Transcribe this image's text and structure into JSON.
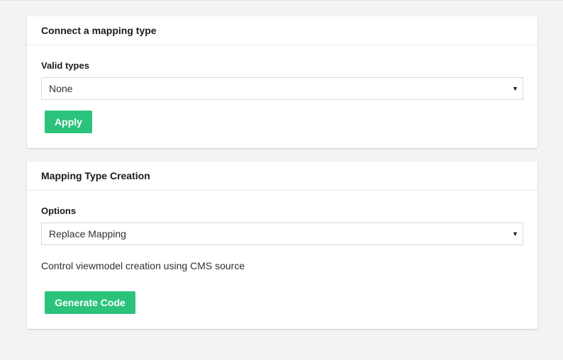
{
  "panel1": {
    "title": "Connect a mapping type",
    "label": "Valid types",
    "select_value": "None",
    "button_label": "Apply"
  },
  "panel2": {
    "title": "Mapping Type Creation",
    "label": "Options",
    "select_value": "Replace Mapping",
    "help_text": "Control viewmodel creation using CMS source",
    "button_label": "Generate Code"
  },
  "icons": {
    "caret": "▼"
  },
  "colors": {
    "page_background": "#f4f3f3",
    "panel_background": "#ffffff",
    "button_green": "#2bc37c"
  }
}
